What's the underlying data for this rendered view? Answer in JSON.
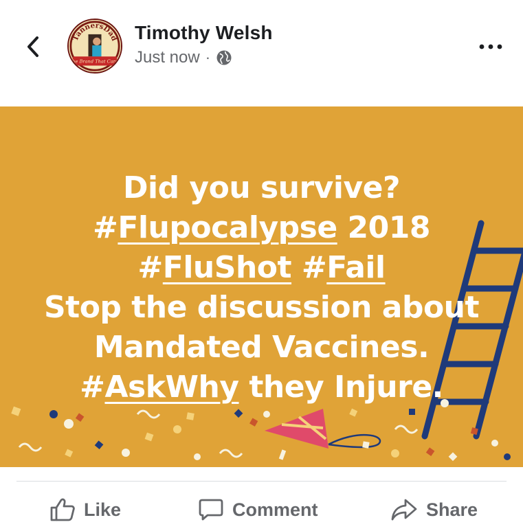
{
  "header": {
    "back_icon": "chevron-left-icon",
    "author_name": "Timothy Welsh",
    "timestamp": "Just now",
    "separator": "·",
    "privacy_icon": "globe-icon",
    "more_icon": "more-dots-icon",
    "avatar": {
      "arc_text": "TannersDad",
      "banner_text": "The Brand That Cares"
    }
  },
  "post": {
    "background_color": "#e0a337",
    "lines": [
      [
        {
          "text": "Did you survive?",
          "tag": false
        }
      ],
      [
        {
          "text": "#",
          "tag": false
        },
        {
          "text": "Flupocalypse",
          "tag": true
        },
        {
          "text": " 2018",
          "tag": false
        }
      ],
      [
        {
          "text": "#",
          "tag": false
        },
        {
          "text": "FluShot",
          "tag": true
        },
        {
          "text": " #",
          "tag": false
        },
        {
          "text": "Fail",
          "tag": true
        }
      ],
      [
        {
          "text": "Stop the discussion about",
          "tag": false
        }
      ],
      [
        {
          "text": "Mandated Vaccines.",
          "tag": false
        }
      ],
      [
        {
          "text": "#",
          "tag": false
        },
        {
          "text": "AskWhy",
          "tag": true
        },
        {
          "text": " they Injure.",
          "tag": false
        }
      ]
    ]
  },
  "actions": {
    "like_label": "Like",
    "like_icon": "thumbs-up-icon",
    "comment_label": "Comment",
    "comment_icon": "comment-bubble-icon",
    "share_label": "Share",
    "share_icon": "share-arrow-icon"
  },
  "colors": {
    "text_primary": "#1c1e21",
    "text_secondary": "#65676b",
    "ladder": "#1f3a7a"
  }
}
